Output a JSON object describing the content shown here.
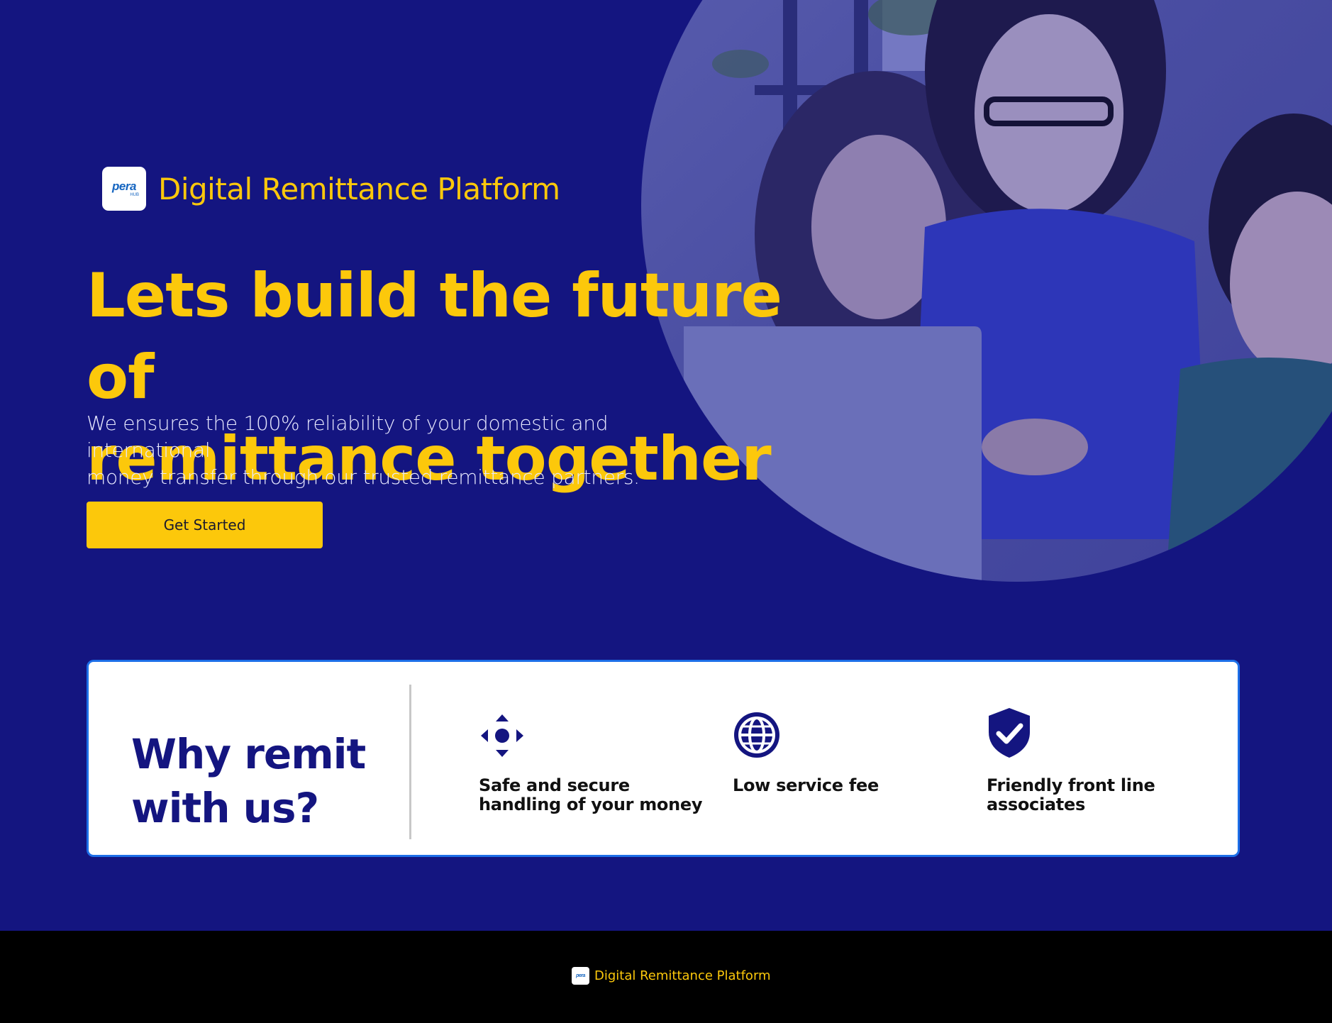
{
  "brand": {
    "logo_text": "pera",
    "logo_sub": "HUB",
    "title": "Digital Remittance Platform"
  },
  "hero": {
    "headline_line1": "Lets build the future of",
    "headline_line2": "remittance together",
    "subtext_line1": "We ensures the 100% reliability of your domestic and international",
    "subtext_line2": "money transfer through our trusted remittance partners.",
    "cta_label": "Get Started"
  },
  "why": {
    "title_line1": "Why remit",
    "title_line2": "with us?",
    "features": [
      {
        "icon": "move-arrows-icon",
        "line1": "Safe and secure",
        "line2": "handling of your money"
      },
      {
        "icon": "globe-icon",
        "line1": "Low service fee",
        "line2": ""
      },
      {
        "icon": "shield-check-icon",
        "line1": "Friendly front line",
        "line2": "associates"
      }
    ]
  },
  "footer": {
    "logo_text": "pera",
    "title": "Digital Remittance Platform"
  },
  "colors": {
    "background": "#141580",
    "accent": "#fcc80b",
    "card_border": "#1d6fe8",
    "footer": "#000000"
  }
}
